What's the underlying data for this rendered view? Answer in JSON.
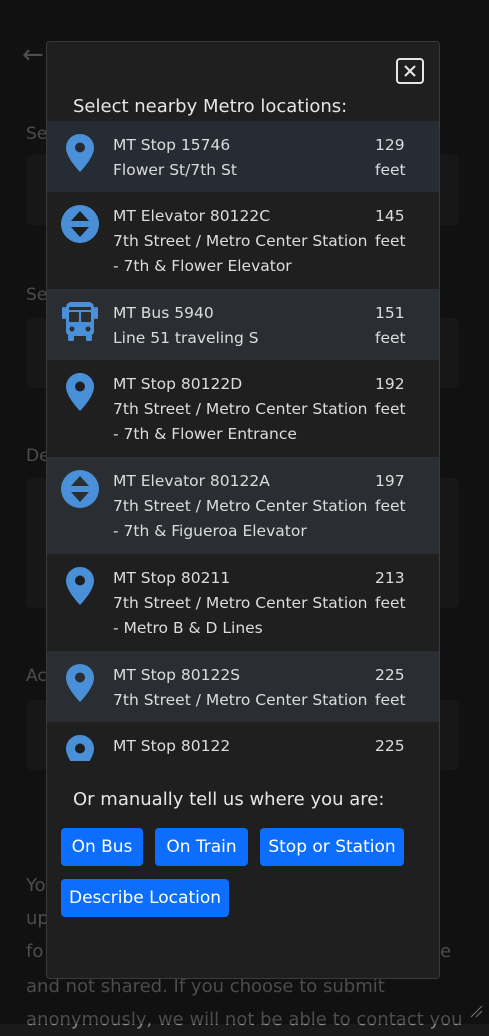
{
  "background": {
    "back_icon": "arrow-left-icon",
    "label_letters": [
      "Se",
      "Se",
      "De",
      "Ac"
    ],
    "text_lines": [
      "Yo",
      "up",
      "fo",
      "and not shared. If you choose to submit",
      "anonymously, we will not be able to contact you"
    ],
    "trailing_char": "e"
  },
  "modal": {
    "close_icon": "close-icon",
    "title": "Select nearby Metro locations:",
    "locations": [
      {
        "icon": "map-pin-icon",
        "name": "MT Stop 15746",
        "desc": "Flower St/7th St",
        "dist_num": "129",
        "dist_unit": "feet"
      },
      {
        "icon": "elevator-icon",
        "name": "MT Elevator 80122C",
        "desc": "7th Street / Metro Center Station - 7th & Flower Elevator",
        "dist_num": "145",
        "dist_unit": "feet"
      },
      {
        "icon": "bus-icon",
        "name": "MT Bus 5940",
        "desc": "Line 51 traveling S",
        "dist_num": "151",
        "dist_unit": "feet"
      },
      {
        "icon": "map-pin-icon",
        "name": "MT Stop 80122D",
        "desc": "7th Street / Metro Center Station - 7th & Flower Entrance",
        "dist_num": "192",
        "dist_unit": "feet"
      },
      {
        "icon": "elevator-icon",
        "name": "MT Elevator 80122A",
        "desc": "7th Street / Metro Center Station - 7th & Figueroa Elevator",
        "dist_num": "197",
        "dist_unit": "feet"
      },
      {
        "icon": "map-pin-icon",
        "name": "MT Stop 80211",
        "desc": "7th Street / Metro Center Station - Metro B & D Lines",
        "dist_num": "213",
        "dist_unit": "feet"
      },
      {
        "icon": "map-pin-icon",
        "name": "MT Stop 80122S",
        "desc": "7th Street / Metro Center Station",
        "dist_num": "225",
        "dist_unit": "feet"
      },
      {
        "icon": "map-pin-icon",
        "name": "MT Stop 80122",
        "desc": "",
        "dist_num": "225",
        "dist_unit": ""
      }
    ],
    "manual_label": "Or manually tell us where you are:",
    "buttons": {
      "on_bus": "On Bus",
      "on_train": "On Train",
      "stop_or_station": "Stop or Station",
      "describe_location": "Describe Location"
    }
  },
  "colors": {
    "accent": "#0d6efd",
    "icon": "#4a90d9",
    "modal_bg": "#1f1f1f",
    "row_alt": "#2a2d31"
  }
}
